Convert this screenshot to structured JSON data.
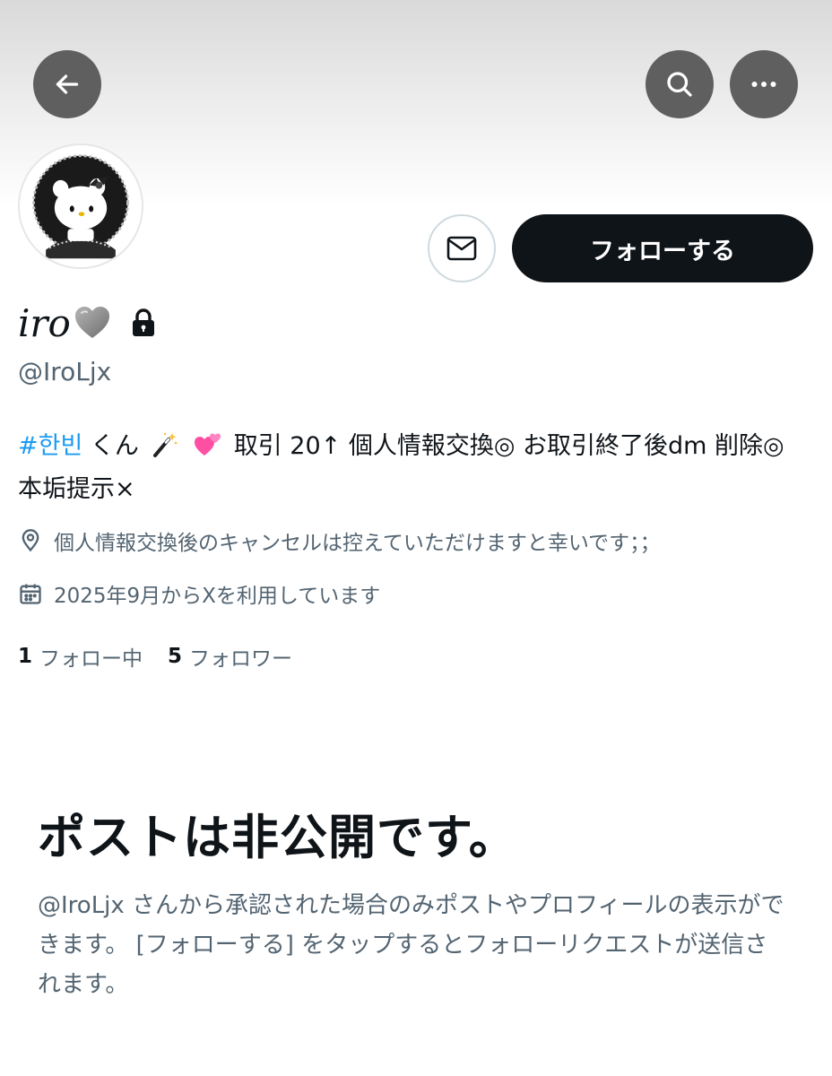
{
  "header": {
    "back_icon": "arrow-left-icon",
    "search_icon": "search-icon",
    "more_icon": "more-horizontal-icon"
  },
  "profile": {
    "display_name": "iro",
    "name_emoji": "grey-heart",
    "protected_icon": "lock-icon",
    "handle": "@IroLjx",
    "bio_hashtag": "#한빈",
    "bio_part1": "くん",
    "bio_emojis": [
      "magic-wand",
      "two-hearts"
    ],
    "bio_part2": "取引 20↑ 個人情報交換◎ お取引終了後dm 削除◎ 本垢提示×",
    "location": "個人情報交換後のキャンセルは控えていただけますと幸いです；；",
    "joined": "2025年9月からXを利用しています",
    "following_count": "1",
    "following_label": "フォロー中",
    "followers_count": "5",
    "followers_label": "フォロワー"
  },
  "actions": {
    "message_icon": "mail-icon",
    "follow_label": "フォローする"
  },
  "private_notice": {
    "title": "ポストは非公開です。",
    "description": "@IroLjx さんから承認された場合のみポストやプロフィールの表示ができます。 [フォローする] をタップするとフォローリクエストが送信されます。"
  },
  "colors": {
    "text_primary": "#0f1419",
    "text_secondary": "#536471",
    "link": "#1d9bf0",
    "button_dark": "#0f1419",
    "header_button": "#5f5f5f"
  }
}
